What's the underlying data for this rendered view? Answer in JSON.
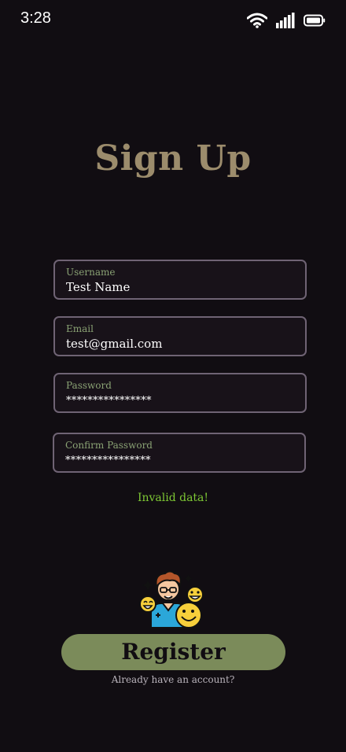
{
  "status_bar": {
    "time": "3:28",
    "icons": [
      "wifi-icon",
      "signal-icon",
      "battery-icon"
    ]
  },
  "title": "Sign Up",
  "form": {
    "username": {
      "label": "Username",
      "value": "Test Name"
    },
    "email": {
      "label": "Email",
      "value": "test@gmail.com"
    },
    "password": {
      "label": "Password",
      "value": "****************"
    },
    "confirm_password": {
      "label": "Confirm Password",
      "value": "****************"
    }
  },
  "error_message": "Invalid data!",
  "illustration": "people-smileys-illustration",
  "register_label": "Register",
  "login_link": "Already have an account?",
  "colors": {
    "background": "#110d12",
    "title": "#9c8c6c",
    "field_border": "#6f6374",
    "label": "#8aa274",
    "error": "#7ec834",
    "button": "#7b8b5a"
  }
}
